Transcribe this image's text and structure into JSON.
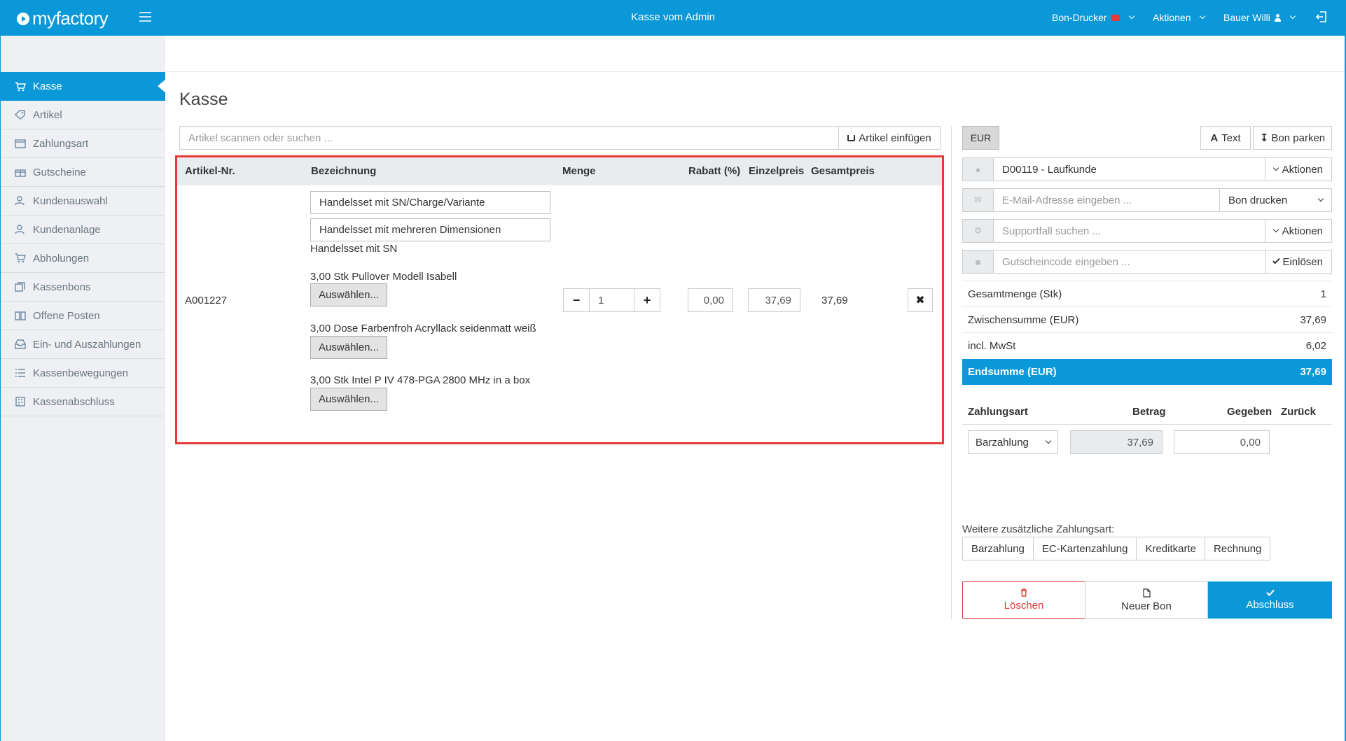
{
  "app": {
    "logo_text": "myfactory",
    "title": "Kasse vom Admin",
    "menu_printer": "Bon-Drucker",
    "menu_actions": "Aktionen",
    "menu_user": "Bauer Willi"
  },
  "sidebar": {
    "items": [
      {
        "label": "Kasse",
        "icon": "cart-icon",
        "active": true
      },
      {
        "label": "Artikel",
        "icon": "tag-icon"
      },
      {
        "label": "Zahlungsart",
        "icon": "wallet-icon"
      },
      {
        "label": "Gutscheine",
        "icon": "gift-icon"
      },
      {
        "label": "Kundenauswahl",
        "icon": "user-search-icon"
      },
      {
        "label": "Kundenanlage",
        "icon": "user-add-icon"
      },
      {
        "label": "Abholungen",
        "icon": "cart-pickup-icon"
      },
      {
        "label": "Kassenbons",
        "icon": "receipts-icon"
      },
      {
        "label": "Offene Posten",
        "icon": "book-icon"
      },
      {
        "label": "Ein- und Auszahlungen",
        "icon": "inbox-icon"
      },
      {
        "label": "Kassenbewegungen",
        "icon": "list-icon"
      },
      {
        "label": "Kassenabschluss",
        "icon": "calculator-icon"
      }
    ]
  },
  "main": {
    "page_title": "Kasse",
    "search_placeholder": "Artikel scannen oder suchen ...",
    "insert_button": "Artikel einfügen",
    "columns": [
      "Artikel-Nr.",
      "Bezeichnung",
      "Menge",
      "Rabatt (%)",
      "Einzelpreis",
      "Gesamtpreis"
    ],
    "row": {
      "article_no": "A001227",
      "name_line1": "Handelsset mit SN/Charge/Variante",
      "name_line2": "Handelsset mit mehreren Dimensionen",
      "name_line3": "Handelsset mit SN",
      "components": [
        {
          "text": "3,00 Stk Pullover Modell Isabell",
          "button": "Auswählen..."
        },
        {
          "text": "3,00 Dose Farbenfroh Acryllack seidenmatt weiß",
          "button": "Auswählen..."
        },
        {
          "text": "3,00 Stk Intel P IV 478-PGA 2800 MHz in a box",
          "button": "Auswählen..."
        }
      ],
      "quantity": "1",
      "discount": "0,00",
      "unit_price": "37,69",
      "total_price": "37,69"
    }
  },
  "panel": {
    "currency": "EUR",
    "text_button": "Text",
    "park_button": "Bon parken",
    "customer": "D00119 - Laufkunde",
    "customer_actions": "Aktionen",
    "email_placeholder": "E-Mail-Adresse eingeben ...",
    "print_select": "Bon drucken",
    "support_placeholder": "Supportfall suchen ...",
    "support_actions": "Aktionen",
    "voucher_placeholder": "Gutscheincode eingeben ...",
    "redeem_button": "Einlösen",
    "summary": [
      {
        "label": "Gesamtmenge (Stk)",
        "value": "1"
      },
      {
        "label": "Zwischensumme (EUR)",
        "value": "37,69"
      },
      {
        "label": "incl. MwSt",
        "value": "6,02"
      }
    ],
    "total_label": "Endsumme (EUR)",
    "total_value": "37,69",
    "pay_headers": [
      "Zahlungsart",
      "Betrag",
      "Gegeben",
      "Zurück"
    ],
    "pay_method": "Barzahlung",
    "pay_amount": "37,69",
    "pay_given": "0,00",
    "extra_label": "Weitere zusätzliche Zahlungsart:",
    "extra_methods": [
      "Barzahlung",
      "EC-Kartenzahlung",
      "Kreditkarte",
      "Rechnung"
    ],
    "btn_delete": "Löschen",
    "btn_new": "Neuer Bon",
    "btn_done": "Abschluss"
  }
}
